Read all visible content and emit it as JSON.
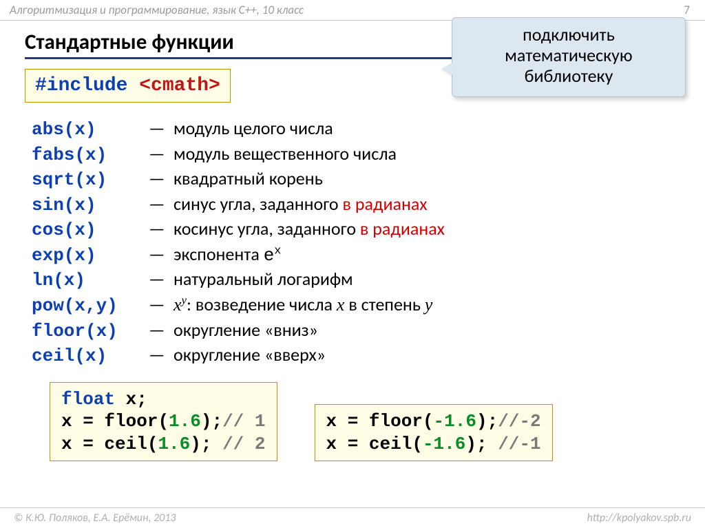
{
  "header": {
    "course": "Алгоритмизация и программирование, язык  C++, 10 класс",
    "page": "7"
  },
  "title": "Стандартные функции",
  "include": {
    "directive": "#include",
    "header_name": "<cmath>"
  },
  "callout": {
    "line1": "подключить",
    "line2": "математическую",
    "line3": "библиотеку"
  },
  "functions": [
    {
      "name": "abs(x)",
      "desc_plain": "модуль целого числа"
    },
    {
      "name": "fabs(x)",
      "desc_plain": "модуль вещественного числа"
    },
    {
      "name": "sqrt(x)",
      "desc_plain": "квадратный корень"
    },
    {
      "name": "sin(x)",
      "desc_prefix": "синус угла, заданного ",
      "desc_red": "в радианах"
    },
    {
      "name": "cos(x)",
      "desc_prefix": "косинус угла, заданного ",
      "desc_red": "в радианах"
    },
    {
      "name": "exp(x)",
      "desc_prefix": "экспонента ",
      "mono_base": "e",
      "mono_sup": "x"
    },
    {
      "name": "ln(x)",
      "desc_plain": "натуральный логарифм"
    },
    {
      "name": "pow(x,y)",
      "pow_base": "x",
      "pow_sup": "y",
      "pow_rest": ": возведение числа ",
      "pow_x": "x",
      "pow_mid": " в степень ",
      "pow_y": "y"
    },
    {
      "name": "floor(x)",
      "desc_plain": "округление «вниз»"
    },
    {
      "name": "ceil(x)",
      "desc_plain": "округление «вверх»"
    }
  ],
  "example_left": {
    "l1_type": "float",
    "l1_rest": " x;",
    "l2_pre": "x = ",
    "l2_fn": "floor",
    "l2_arg": "1.6",
    "l2_cmt": "// 1",
    "l3_pre": "x = ",
    "l3_fn": "ceil",
    "l3_arg": "1.6",
    "l3_cmt": "// 2"
  },
  "example_right": {
    "l1_pre": "x = ",
    "l1_fn": "floor",
    "l1_arg": "-1.6",
    "l1_cmt": "//-2",
    "l2_pre": "x = ",
    "l2_fn": "ceil",
    "l2_arg": "-1.6",
    "l2_cmt": "//-1"
  },
  "footer": {
    "authors": "© К.Ю. Поляков, Е.А. Ерёмин, 2013",
    "url": "http://kpolyakov.spb.ru"
  }
}
